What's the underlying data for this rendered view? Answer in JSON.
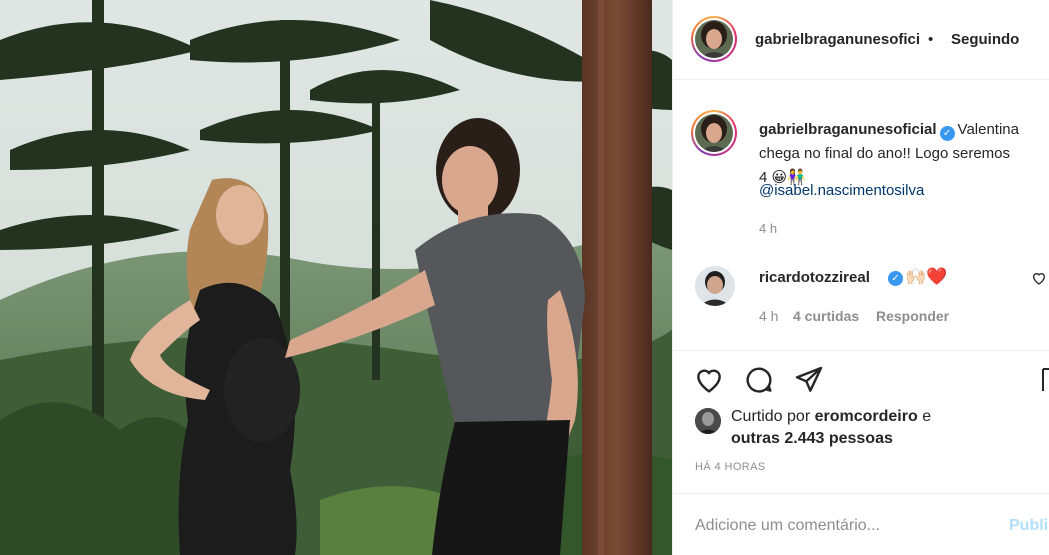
{
  "post": {
    "photo_alt": "",
    "author": "gabrielbraganunesofici",
    "header_separator": "•",
    "follow_status": "Seguindo"
  },
  "caption": {
    "username": "gabrielbraganunesoficial",
    "line1": "Valentina",
    "line2": "chega no final do ano!! Logo seremos",
    "line3": "4",
    "emojis": "😀👫",
    "mention": "@isabel.nascimentosilva",
    "time": "4 h"
  },
  "comment": {
    "username": "ricardotozzireal",
    "text": "🙌🏻❤️",
    "time": "4 h",
    "likes": "4 curtidas",
    "reply": "Responder"
  },
  "likes": {
    "prefix": "Curtido por",
    "liker": "eromcordeiro",
    "suffix": "e",
    "others": "outras 2.443 pessoas"
  },
  "timestamp": "HÁ 4 HORAS",
  "add_comment": {
    "placeholder": "Adicione um comentário...",
    "publish": "Publi"
  },
  "colors": {
    "verified": "#3897f0",
    "link": "#00376b",
    "muted": "#8e8e8e",
    "publish_disabled": "#b2dffc"
  },
  "icons": [
    "heart-icon",
    "comment-icon",
    "share-icon",
    "bookmark-icon",
    "verified-badge-icon"
  ]
}
